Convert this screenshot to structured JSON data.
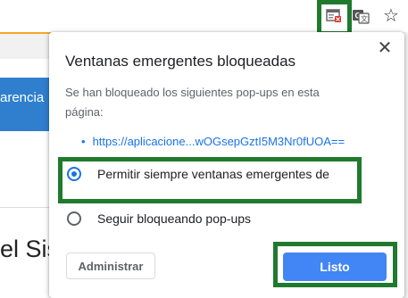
{
  "toolbar": {
    "icons": [
      "popup-blocked-icon",
      "translate-icon",
      "star-icon"
    ]
  },
  "background_page": {
    "band_text": "arencia",
    "heading_text": "el Sis"
  },
  "dialog": {
    "title": "Ventanas emergentes bloqueadas",
    "description": "Se han bloqueado los siguientes pop-ups en esta página:",
    "blocked_links": [
      "https://aplicacione...wOGsepGztI5M3Nr0fUOA=="
    ],
    "options": [
      {
        "label": "Permitir siempre ventanas emergentes de",
        "selected": true
      },
      {
        "label": "Seguir bloqueando pop-ups",
        "selected": false
      }
    ],
    "manage_button": "Administrar",
    "done_button": "Listo",
    "close_glyph": "✕"
  },
  "colors": {
    "accent": "#4285f4",
    "link": "#1a73e8",
    "highlight": "#1f7a2e",
    "band": "#2f7fce"
  }
}
